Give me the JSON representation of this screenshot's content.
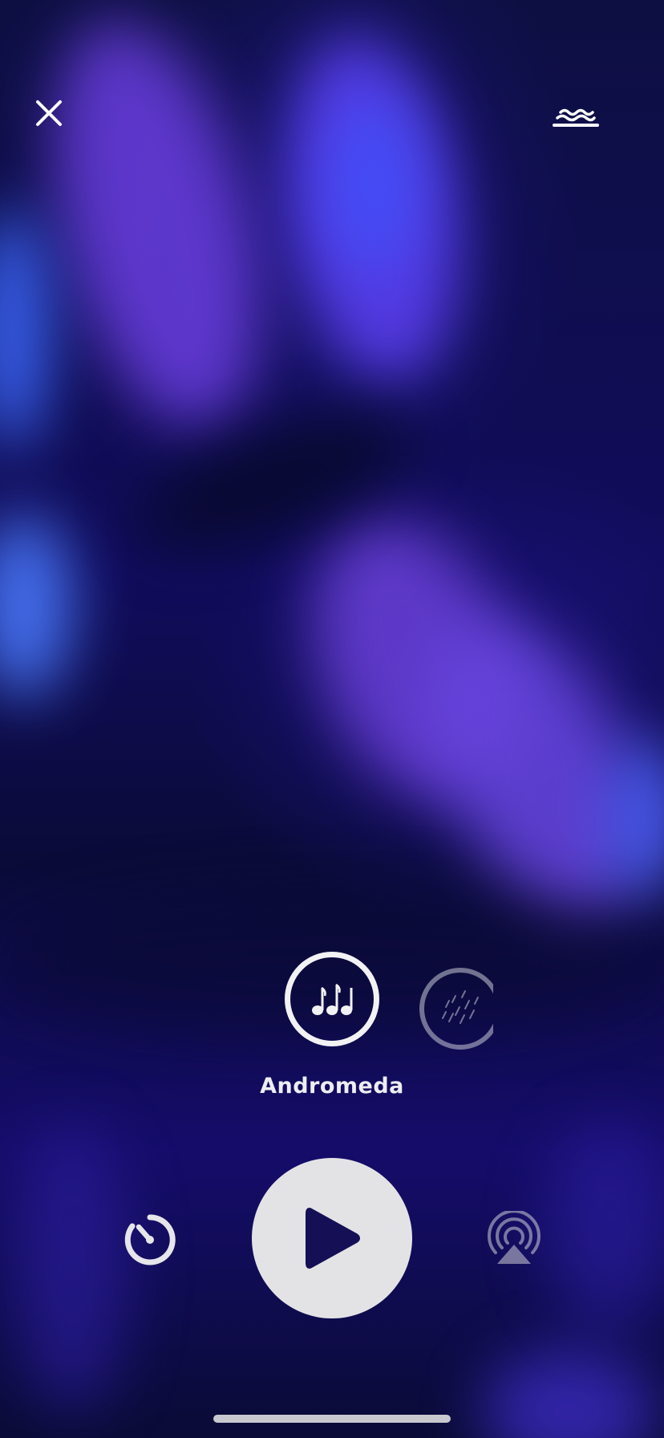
{
  "header": {
    "close_icon": "close-icon",
    "waves_icon": "waves-icon"
  },
  "sounds": {
    "active": {
      "label": "Andromeda",
      "icon": "music-notes-icon"
    },
    "next": {
      "icon": "rain-icon"
    }
  },
  "controls": {
    "timer_icon": "timer-icon",
    "play_icon": "play-icon",
    "airplay_icon": "airplay-icon"
  },
  "colors": {
    "background": "#120c5e",
    "accent": "#6a40e0",
    "foreground": "#f2f2f4",
    "play_button": "#e3e3e6",
    "play_glyph": "#150f55"
  }
}
